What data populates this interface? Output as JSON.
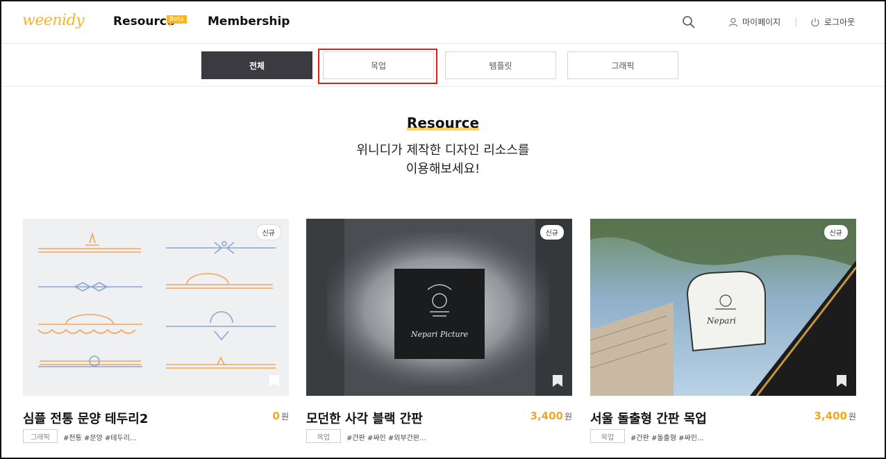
{
  "header": {
    "logo": "weenidy",
    "nav": {
      "resource": "Resource",
      "beta": "Beta",
      "membership": "Membership"
    },
    "my_page": "마이페이지",
    "logout": "로그아웃"
  },
  "tabs": [
    {
      "label": "전체",
      "active": true
    },
    {
      "label": "목업",
      "active": false
    },
    {
      "label": "템플릿",
      "active": false
    },
    {
      "label": "그래픽",
      "active": false
    }
  ],
  "hero": {
    "title": "Resource",
    "subtitle_line1": "위니디가 제작한 디자인 리소스를",
    "subtitle_line2": "이용해보세요!"
  },
  "cards": [
    {
      "badge": "신규",
      "title": "심플 전통 문양 테두리2",
      "price": "0",
      "currency": "원",
      "category": "그래픽",
      "tags": "#전통 #문양 #테두리..."
    },
    {
      "badge": "신규",
      "title": "모던한 사각 블랙 간판",
      "price": "3,400",
      "currency": "원",
      "category": "목업",
      "tags": "#간판 #싸인 #외부간판...",
      "sign_text": "Nepari Picture"
    },
    {
      "badge": "신규",
      "title": "서울 돌출형 간판 목업",
      "price": "3,400",
      "currency": "원",
      "category": "목업",
      "tags": "#간판 #돌출형 #싸인...",
      "sign_text": "Nepari"
    }
  ],
  "colors": {
    "accent": "#f6a623",
    "highlight": "#ffd35c",
    "tab_active": "#3a3a40",
    "annotation": "#d62020"
  }
}
